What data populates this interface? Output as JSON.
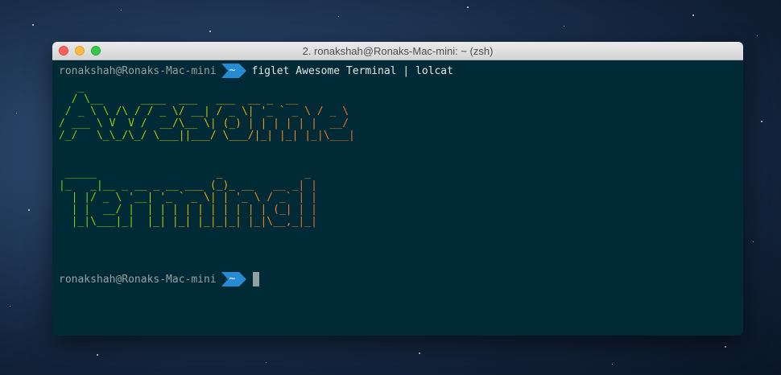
{
  "window": {
    "title": "2. ronakshah@Ronaks-Mac-mini: ~ (zsh)"
  },
  "terminal": {
    "prompt_user": "ronakshah@Ronaks-Mac-mini",
    "prompt_dir": "~",
    "command": "figlet Awesome Terminal | lolcat",
    "figlet_word1": "   _\n  / \\__      ____  ___   ___  __ _  __\n / _ \\ \\ /\\ / / _ \\/ __| / _ \\| '_ ` _ \\ / _ \\\n/ ___ \\ V  V /  __/\\__ \\| (_) | | | | | |  __/\n/_/   \\_\\_/\\_/ \\___||___/ \\___/|_| |_| |_|\\___|",
    "figlet_word2": " _____                   _             _\n|_   _|__ _ __ _ __ ___ (_)_ __   __ _| |\n  | |/ _ \\ '__| '_ ` _ \\| | '_ \\ / _` | |\n  | |  __/ |  | | | | | | | | | | (_| | |\n  |_|\\___|_|  |_| |_| |_|_|_| |_|\\__,_|_|"
  },
  "colors": {
    "terminal_bg": "#002b36",
    "prompt_segment": "#268bd2",
    "text": "#93a1a1"
  }
}
